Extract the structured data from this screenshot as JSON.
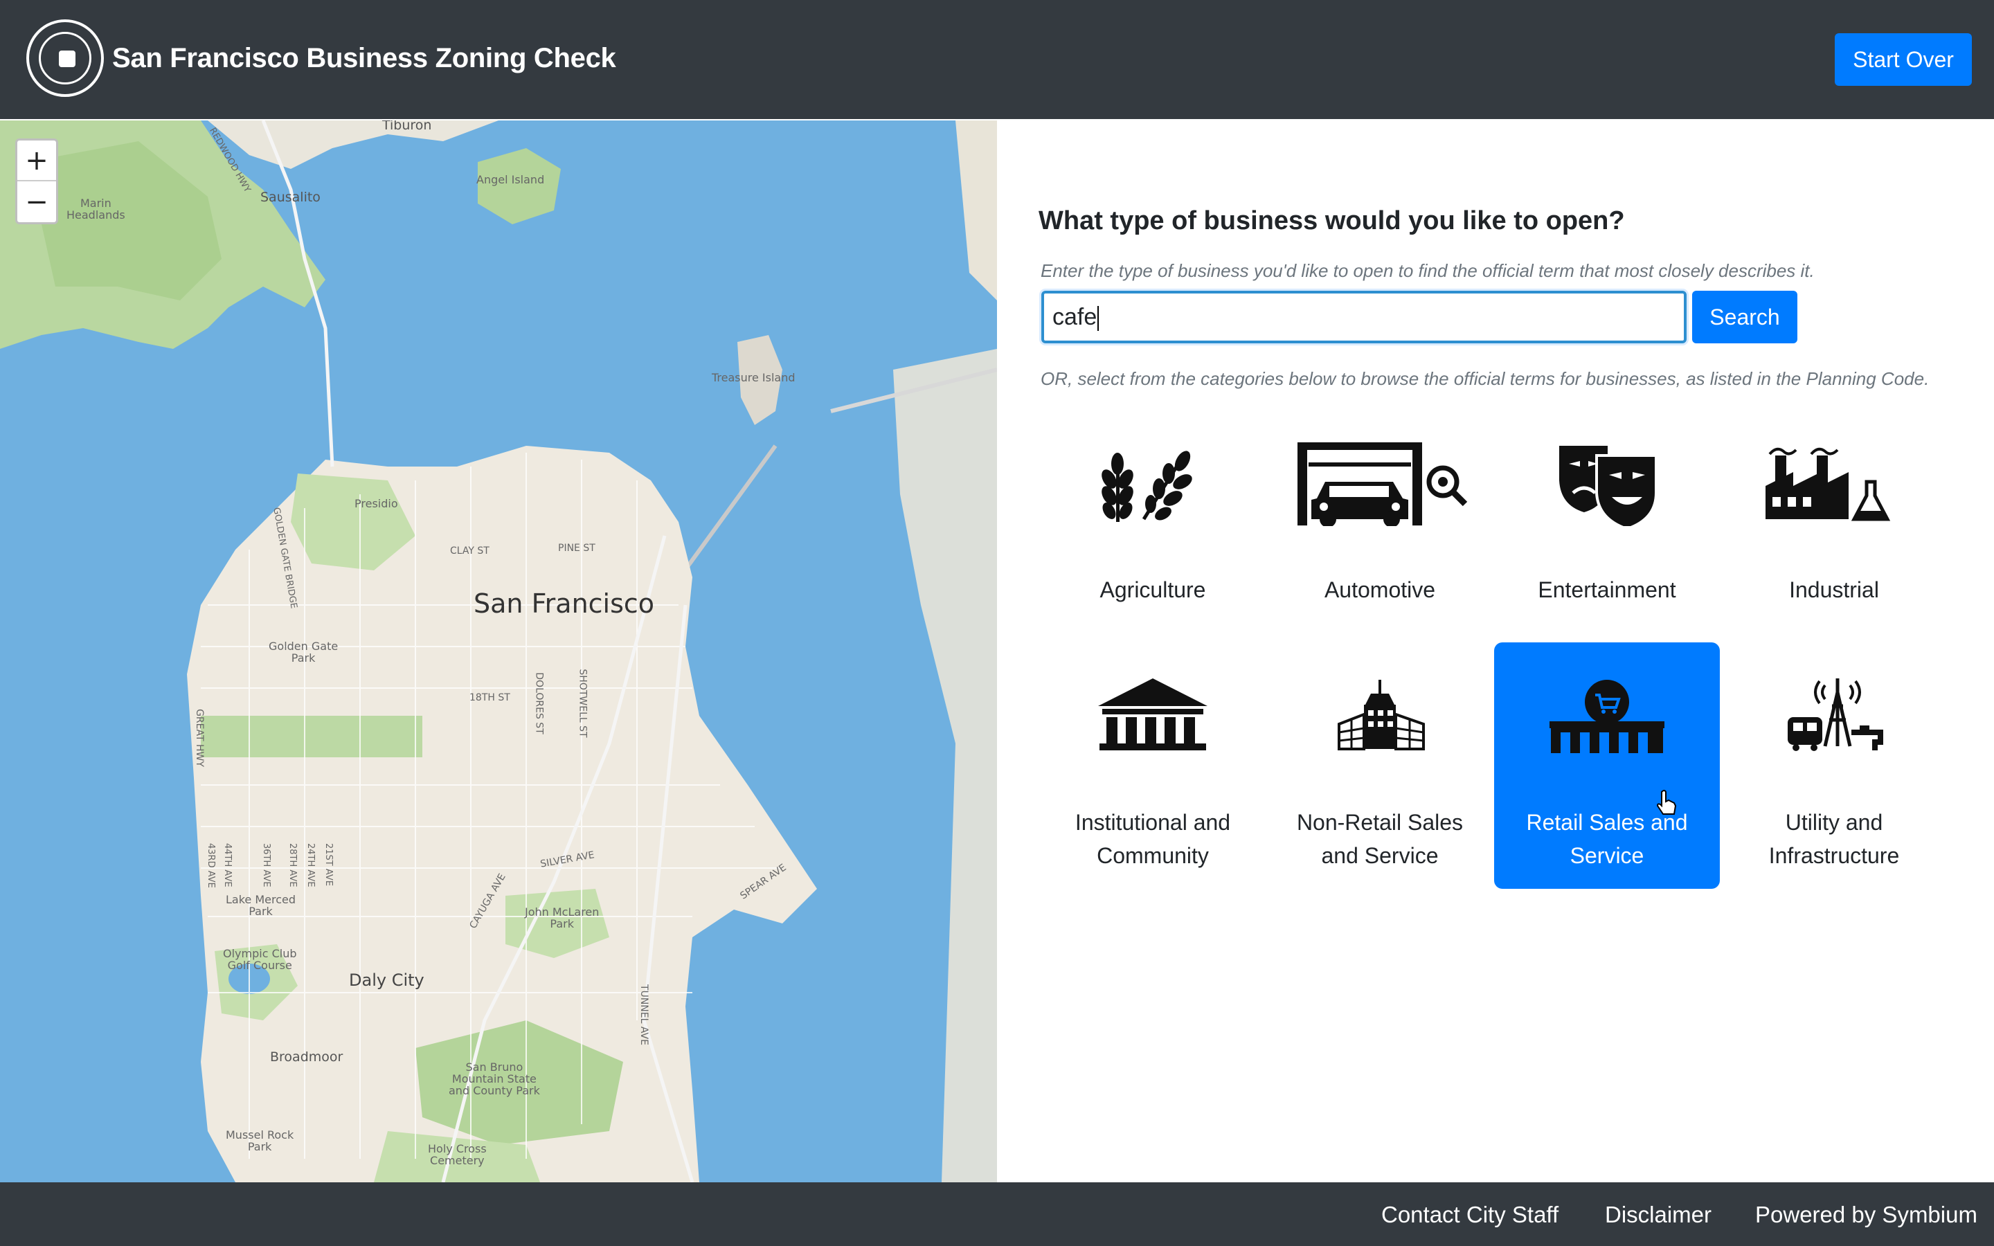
{
  "header": {
    "title": "San Francisco Business Zoning Check",
    "start_over_label": "Start Over"
  },
  "map": {
    "zoom_in": "+",
    "zoom_out": "−",
    "labels": {
      "tiburon": "Tiburon",
      "sausalito": "Sausalito",
      "marin_headlands": "Marin\nHeadlands",
      "angel_island": "Angel Island",
      "treasure_island": "Treasure Island",
      "presidio": "Presidio",
      "san_francisco": "San Francisco",
      "golden_gate_park": "Golden Gate\nPark",
      "lake_merced_park": "Lake Merced\nPark",
      "olympic_club": "Olympic Club\nGolf Course",
      "daly_city": "Daly City",
      "john_mclaren": "John McLaren\nPark",
      "broadmoor": "Broadmoor",
      "san_bruno": "San Bruno\nMountain State\nand County Park",
      "mussel_rock": "Mussel Rock\nPark",
      "holy_cross": "Holy Cross\nCemetery",
      "clay_st": "CLAY ST",
      "pine_st": "PINE ST",
      "eighteenth_st": "18TH ST",
      "silver_ave": "SILVER AVE",
      "cayuga_ave": "CAYUGA AVE",
      "spear_ave": "SPEAR AVE",
      "great_hwy": "GREAT HWY",
      "dolores_st": "DOLORES ST",
      "shotwell_st": "SHOTWELL ST",
      "tunnel_ave": "TUNNEL AVE",
      "golden_gate_bridge": "GOLDEN GATE BRIDGE",
      "redwood_hwy": "REDWOOD HWY",
      "fortythird_ave": "43RD AVE",
      "fortyfourth_ave": "44TH AVE",
      "thirtysixth_ave": "36TH AVE",
      "twentyeighth_ave": "28TH AVE",
      "twentyfourth_ave": "24TH AVE",
      "twentyfirst_ave": "21ST AVE"
    }
  },
  "panel": {
    "question": "What type of business would you like to open?",
    "hint": "Enter the type of business you'd like to open to find the official term that most closely describes it.",
    "search_value": "cafe",
    "search_label": "Search",
    "browse_hint": "OR, select from the categories below to browse the official terms for businesses, as listed in the Planning Code.",
    "categories": [
      {
        "label": "Agriculture",
        "icon": "wheat-icon"
      },
      {
        "label": "Automotive",
        "icon": "car-garage-icon"
      },
      {
        "label": "Entertainment",
        "icon": "theater-masks-icon"
      },
      {
        "label": "Industrial",
        "icon": "factory-icon"
      },
      {
        "label": "Institutional and Community",
        "icon": "institution-icon"
      },
      {
        "label": "Non-Retail Sales and Service",
        "icon": "office-building-icon"
      },
      {
        "label": "Retail Sales and Service",
        "icon": "storefront-cart-icon",
        "selected": true
      },
      {
        "label": "Utility and Infrastructure",
        "icon": "utility-tower-icon"
      }
    ]
  },
  "footer": {
    "contact": "Contact City Staff",
    "disclaimer": "Disclaimer",
    "powered": "Powered by Symbium"
  },
  "colors": {
    "header_bg": "#343a40",
    "accent": "#007bff",
    "water": "#6fb0e0",
    "land": "#efeae0"
  }
}
